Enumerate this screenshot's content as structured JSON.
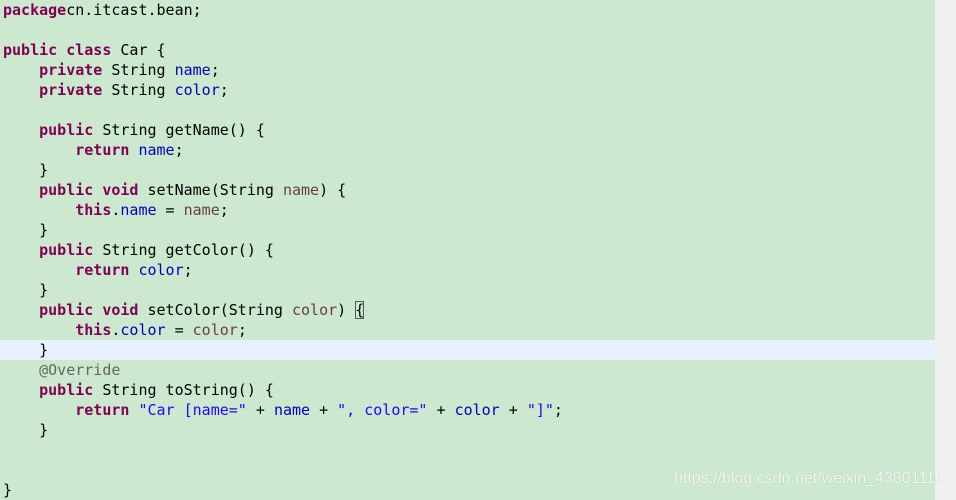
{
  "colors": {
    "background": "#cce8cf",
    "keyword": "#7f0055",
    "field": "#0000c0",
    "parameter": "#6a3e3e",
    "string": "#2a00ff",
    "annotation": "#646464",
    "current_line": "#e8f2fe"
  },
  "current_line_index": 17,
  "code_lines": [
    [
      [
        "kw",
        "package"
      ],
      [
        "",
        "cn.itcast.bean;"
      ]
    ],
    [],
    [
      [
        "kw",
        "public"
      ],
      [
        "",
        " "
      ],
      [
        "kw",
        "class"
      ],
      [
        "",
        " Car {"
      ]
    ],
    [
      [
        "",
        "    "
      ],
      [
        "kw",
        "private"
      ],
      [
        "",
        " String "
      ],
      [
        "field",
        "name"
      ],
      [
        "",
        ";"
      ]
    ],
    [
      [
        "",
        "    "
      ],
      [
        "kw",
        "private"
      ],
      [
        "",
        " String "
      ],
      [
        "field",
        "color"
      ],
      [
        "",
        ";"
      ]
    ],
    [],
    [
      [
        "",
        "    "
      ],
      [
        "kw",
        "public"
      ],
      [
        "",
        " String getName() {"
      ]
    ],
    [
      [
        "",
        "        "
      ],
      [
        "kw",
        "return"
      ],
      [
        "",
        " "
      ],
      [
        "field",
        "name"
      ],
      [
        "",
        ";"
      ]
    ],
    [
      [
        "",
        "    }"
      ]
    ],
    [
      [
        "",
        "    "
      ],
      [
        "kw",
        "public"
      ],
      [
        "",
        " "
      ],
      [
        "kw",
        "void"
      ],
      [
        "",
        " setName(String "
      ],
      [
        "param",
        "name"
      ],
      [
        "",
        ") {"
      ]
    ],
    [
      [
        "",
        "        "
      ],
      [
        "kw",
        "this"
      ],
      [
        "",
        "."
      ],
      [
        "field",
        "name"
      ],
      [
        "",
        " = "
      ],
      [
        "param",
        "name"
      ],
      [
        "",
        ";"
      ]
    ],
    [
      [
        "",
        "    }"
      ]
    ],
    [
      [
        "",
        "    "
      ],
      [
        "kw",
        "public"
      ],
      [
        "",
        " String getColor() {"
      ]
    ],
    [
      [
        "",
        "        "
      ],
      [
        "kw",
        "return"
      ],
      [
        "",
        " "
      ],
      [
        "field",
        "color"
      ],
      [
        "",
        ";"
      ]
    ],
    [
      [
        "",
        "    }"
      ]
    ],
    [
      [
        "",
        "    "
      ],
      [
        "kw",
        "public"
      ],
      [
        "",
        " "
      ],
      [
        "kw",
        "void"
      ],
      [
        "",
        " setColor(String "
      ],
      [
        "param",
        "color"
      ],
      [
        "",
        ") "
      ],
      [
        "match",
        "{"
      ]
    ],
    [
      [
        "",
        "        "
      ],
      [
        "kw",
        "this"
      ],
      [
        "",
        "."
      ],
      [
        "field",
        "color"
      ],
      [
        "",
        " = "
      ],
      [
        "param",
        "color"
      ],
      [
        "",
        ";"
      ]
    ],
    [
      [
        "",
        "    }"
      ]
    ],
    [
      [
        "",
        "    "
      ],
      [
        "ann",
        "@Override"
      ]
    ],
    [
      [
        "",
        "    "
      ],
      [
        "kw",
        "public"
      ],
      [
        "",
        " String toString() {"
      ]
    ],
    [
      [
        "",
        "        "
      ],
      [
        "kw",
        "return"
      ],
      [
        "",
        " "
      ],
      [
        "str",
        "\"Car [name=\""
      ],
      [
        "",
        " + "
      ],
      [
        "field",
        "name"
      ],
      [
        "",
        " + "
      ],
      [
        "str",
        "\", color=\""
      ],
      [
        "",
        " + "
      ],
      [
        "field",
        "color"
      ],
      [
        "",
        " + "
      ],
      [
        "str",
        "\"]\""
      ],
      [
        "",
        ";"
      ]
    ],
    [
      [
        "",
        "    }"
      ]
    ],
    [],
    [],
    [
      [
        "",
        "}"
      ]
    ]
  ],
  "watermark": "https://blog.csdn.net/weixin_43801116"
}
